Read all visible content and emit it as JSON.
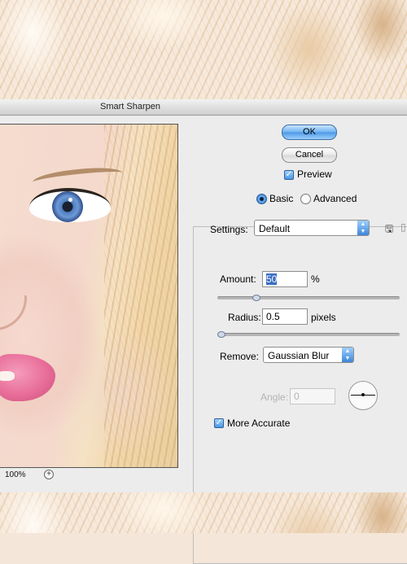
{
  "dialog": {
    "title": "Smart Sharpen",
    "ok_label": "OK",
    "cancel_label": "Cancel",
    "preview_label": "Preview",
    "preview_checked": true,
    "mode_basic_label": "Basic",
    "mode_advanced_label": "Advanced",
    "selected_mode": "Basic",
    "settings_label": "Settings:",
    "settings_value": "Default",
    "amount_label": "Amount:",
    "amount_value": "50",
    "amount_unit": "%",
    "amount_slider_fraction": 0.2,
    "radius_label": "Radius:",
    "radius_value": "0.5",
    "radius_unit": "pixels",
    "radius_slider_fraction": 0.0,
    "remove_label": "Remove:",
    "remove_value": "Gaussian Blur",
    "angle_label": "Angle:",
    "angle_value": "0",
    "more_accurate_label": "More Accurate",
    "more_accurate_checked": true,
    "zoom_level": "100%"
  },
  "icons": [
    "save-settings-icon",
    "delete-settings-icon",
    "zoom-in-icon",
    "dropdown-arrow-icon",
    "angle-dial-icon"
  ],
  "colors": {
    "ok_button": "#6fb1f0",
    "dialog_bg": "#ececec",
    "selection": "#3a6fc4"
  }
}
